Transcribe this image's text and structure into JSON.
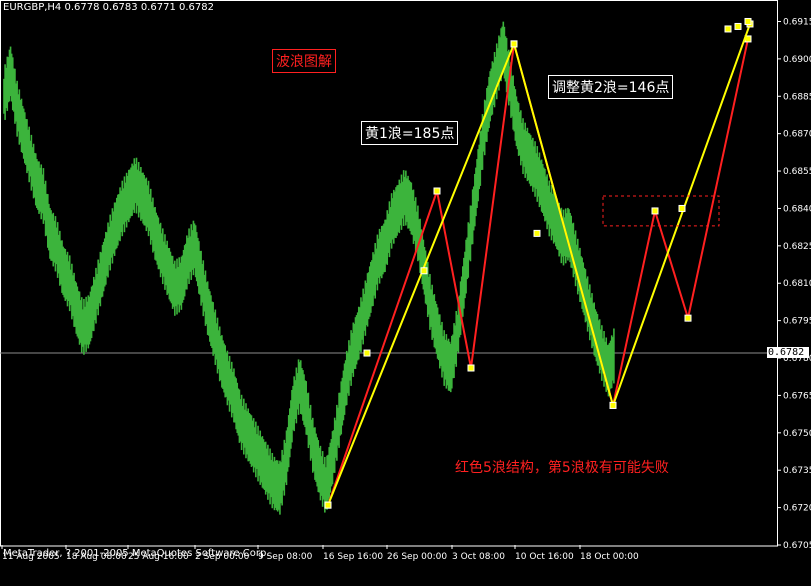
{
  "header": {
    "symbol": "EURGBP,H4",
    "ohlc": "0.6778 0.6783 0.6771 0.6782"
  },
  "copyright": "MetaTrader, ? 2001-2005 MetaQuotes Software Corp.",
  "current_price": "0.6782",
  "annotations": {
    "title": "波浪图解",
    "wave1": "黄1浪=185点",
    "wave2": "调整黄2浪=146点",
    "red_structure": "红色5浪结构，第5浪极有可能失败"
  },
  "colors": {
    "background": "#000000",
    "candles": "#3cb43c",
    "yellow_wave": "#ffff00",
    "red_wave": "#ff2020",
    "axis_text": "#ffffff",
    "grid": "#8c8c8c"
  },
  "chart_data": {
    "type": "line",
    "title": "",
    "xlabel": "",
    "ylabel": "",
    "ylim": [
      0.6705,
      0.6918
    ],
    "y_ticks": [
      "0.6915",
      "0.6900",
      "0.6885",
      "0.6870",
      "0.6855",
      "0.6840",
      "0.6825",
      "0.6810",
      "0.6795",
      "0.6780",
      "0.6765",
      "0.6750",
      "0.6735",
      "0.6720",
      "0.6705"
    ],
    "x_ticks": [
      "11 Aug 2005",
      "18 Aug 08:00",
      "25 Aug 16:00",
      "2 Sep 00:00",
      "9 Sep 08:00",
      "16 Sep 16:00",
      "26 Sep 00:00",
      "3 Oct 08:00",
      "10 Oct 16:00",
      "18 Oct 00:00"
    ],
    "price_series": [
      0.6885,
      0.6895,
      0.688,
      0.687,
      0.686,
      0.685,
      0.6845,
      0.683,
      0.6825,
      0.6815,
      0.681,
      0.68,
      0.6792,
      0.6795,
      0.6805,
      0.6815,
      0.6825,
      0.6833,
      0.684,
      0.6845,
      0.685,
      0.6845,
      0.684,
      0.683,
      0.6822,
      0.6815,
      0.6808,
      0.681,
      0.682,
      0.6825,
      0.6812,
      0.68,
      0.679,
      0.678,
      0.6772,
      0.6765,
      0.6755,
      0.675,
      0.6745,
      0.674,
      0.6735,
      0.673,
      0.6728,
      0.674,
      0.676,
      0.677,
      0.676,
      0.6745,
      0.6735,
      0.6728,
      0.674,
      0.6755,
      0.677,
      0.6782,
      0.679,
      0.68,
      0.681,
      0.682,
      0.6825,
      0.6835,
      0.684,
      0.6845,
      0.684,
      0.683,
      0.6815,
      0.68,
      0.679,
      0.678,
      0.6776,
      0.679,
      0.681,
      0.683,
      0.685,
      0.687,
      0.6885,
      0.6895,
      0.6905,
      0.689,
      0.6875,
      0.6865,
      0.686,
      0.6855,
      0.6848,
      0.684,
      0.6835,
      0.6828,
      0.683,
      0.682,
      0.681,
      0.68,
      0.679,
      0.6782,
      0.6775,
      0.6782
    ],
    "series": [
      {
        "values": [
          {
            "x": "16 Sep 16:00",
            "y": 0.6721
          },
          {
            "x": "26 Sep 00:00",
            "y": 0.6847
          },
          {
            "x": "3 Oct 08:00",
            "y": 0.6776
          },
          {
            "x": "10 Oct 16:00",
            "y": 0.6906
          },
          {
            "x": "18 Oct 00:00",
            "y": 0.6761
          },
          {
            "x": "",
            "y": 0.6839
          },
          {
            "x": "",
            "y": 0.6796
          },
          {
            "x": "",
            "y": 0.6908
          }
        ]
      },
      {
        "values": [
          {
            "x": "16 Sep 16:00",
            "y": 0.6721
          },
          {
            "x": "10 Oct 16:00",
            "y": 0.6906
          },
          {
            "x": "18 Oct 00:00",
            "y": 0.6761
          },
          {
            "x": "",
            "y": 0.6914
          }
        ]
      }
    ],
    "grid": true
  }
}
